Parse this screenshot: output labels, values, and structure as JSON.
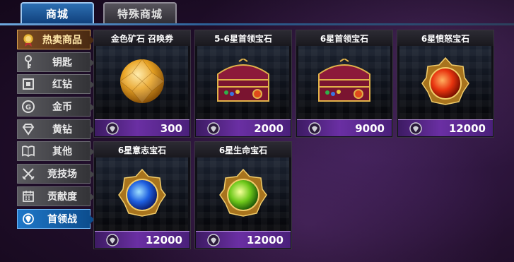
{
  "tabs": [
    {
      "label": "商城",
      "active": true
    },
    {
      "label": "特殊商城",
      "active": false
    }
  ],
  "sidebar": {
    "items": [
      {
        "label": "热卖商品",
        "icon": "medal-icon"
      },
      {
        "label": "钥匙",
        "icon": "key-icon"
      },
      {
        "label": "红钻",
        "icon": "red-diamond-icon"
      },
      {
        "label": "金币",
        "icon": "gold-coin-icon"
      },
      {
        "label": "黄钻",
        "icon": "yellow-diamond-icon"
      },
      {
        "label": "其他",
        "icon": "book-icon"
      },
      {
        "label": "竞技场",
        "icon": "crossed-swords-icon"
      },
      {
        "label": "贡献度",
        "icon": "calendar-icon"
      },
      {
        "label": "首领战",
        "icon": "boss-emblem-icon"
      }
    ],
    "selected": "首领战"
  },
  "shop": {
    "currency_icon": "boss-token-icon",
    "items": [
      {
        "name": "金色矿石 召唤券",
        "price": "300",
        "image": "gold-gem-icon"
      },
      {
        "name": "5-6星首领宝石",
        "price": "2000",
        "image": "treasure-chest-icon"
      },
      {
        "name": "6星首领宝石",
        "price": "9000",
        "image": "treasure-chest-icon"
      },
      {
        "name": "6星愤怒宝石",
        "price": "12000",
        "image": "red-gem-icon"
      },
      {
        "name": "6星意志宝石",
        "price": "12000",
        "image": "blue-gem-icon"
      },
      {
        "name": "6星生命宝石",
        "price": "12000",
        "image": "green-gem-icon"
      }
    ]
  },
  "colors": {
    "accent_blue": "#1f78c9",
    "price_purple": "#6a2fa3",
    "gold": "#e0a62a"
  }
}
